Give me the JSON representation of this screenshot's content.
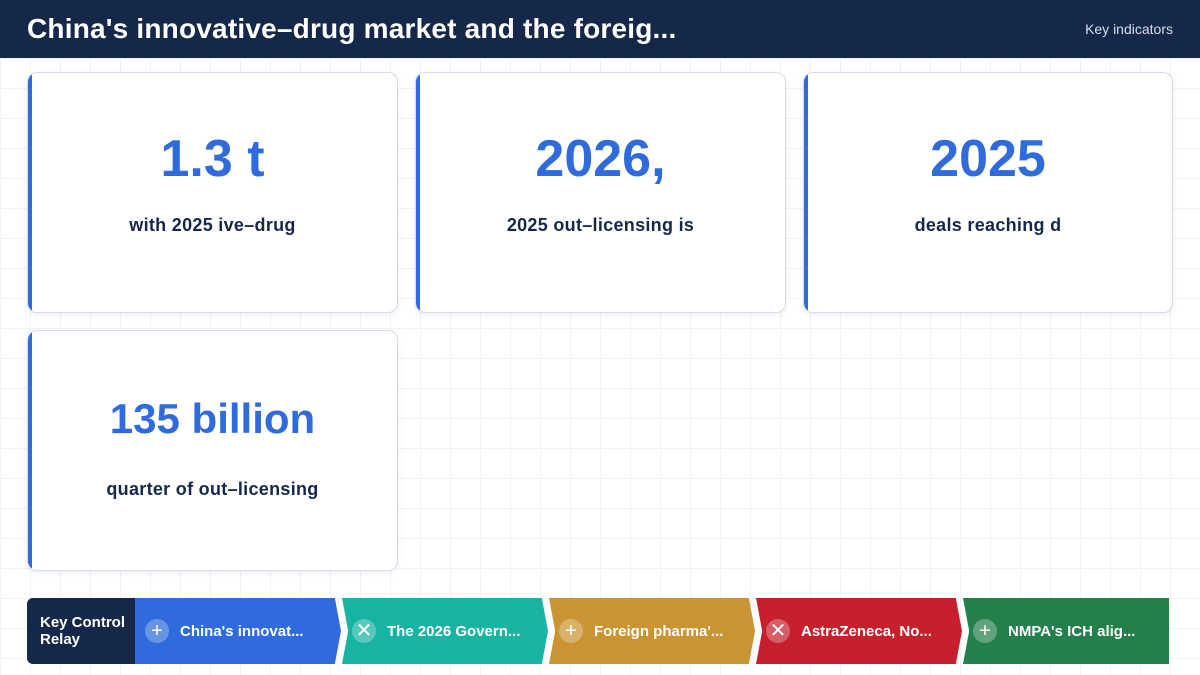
{
  "header": {
    "title": "China's innovative–drug market and the foreig...",
    "tag": "Key indicators"
  },
  "cards": [
    {
      "value": "1.3 t",
      "caption": "with 2025 ive–drug"
    },
    {
      "value": "2026,",
      "caption": "2025 out–licensing is"
    },
    {
      "value": "2025",
      "caption": "deals reaching d"
    },
    {
      "value": "135 billion",
      "caption": "quarter of out–licensing"
    }
  ],
  "relay": {
    "label": "Key Control Relay",
    "steps": [
      {
        "icon": "plus-icon",
        "glyph": "+",
        "text": "China's innovat...",
        "color": "#2f6bdc"
      },
      {
        "icon": "close-icon",
        "glyph": "✕",
        "text": "The 2026 Govern...",
        "color": "#17b3a3"
      },
      {
        "icon": "plus-icon",
        "glyph": "+",
        "text": "Foreign pharma'...",
        "color": "#c99431"
      },
      {
        "icon": "close-icon",
        "glyph": "✕",
        "text": "AstraZeneca, No...",
        "color": "#c7202d"
      },
      {
        "icon": "plus-icon",
        "glyph": "+",
        "text": "NMPA's ICH alig...",
        "color": "#23804a"
      }
    ]
  }
}
